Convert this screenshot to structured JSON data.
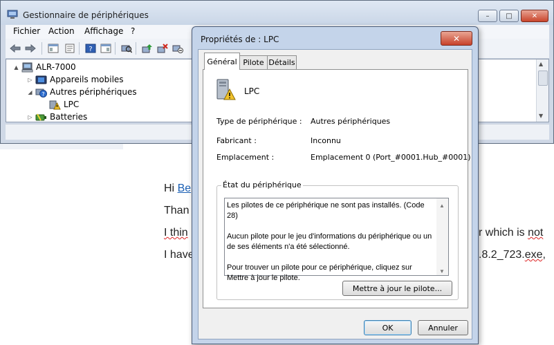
{
  "main_window": {
    "title": "Gestionnaire de périphériques",
    "controls": {
      "minimize": "–",
      "maximize": "□",
      "close": "✕"
    },
    "menu": [
      "Fichier",
      "Action",
      "Affichage",
      "?"
    ],
    "tree": [
      {
        "label": "ALR-7000",
        "icon": "computer-icon",
        "toggle": "▲"
      },
      {
        "label": "Appareils mobiles",
        "icon": "mobile-device-icon",
        "toggle": "▷"
      },
      {
        "label": "Autres périphériques",
        "icon": "unknown-device-icon",
        "toggle": "◢"
      },
      {
        "label": "LPC",
        "icon": "warning-device-icon",
        "toggle": ""
      },
      {
        "label": "Batteries",
        "icon": "battery-icon",
        "toggle": "▷"
      }
    ],
    "scroll_up": "▲",
    "scroll_down": "▼"
  },
  "background_text": {
    "line1_prefix": "Hi ",
    "line1_link": "Be",
    "line2": "Than",
    "line3_left": "I thin",
    "line3_right_a": "r which is ",
    "line3_right_b": "not",
    "line4_left": "I have",
    "line4_right_a": ".8.2_723.",
    "line4_right_b": "exe",
    "line4_right_c": ","
  },
  "dialog": {
    "title": "Propriétés de : LPC",
    "close": "✕",
    "tabs": [
      "Général",
      "Pilote",
      "Détails"
    ],
    "device_name": "LPC",
    "fields": {
      "type_label": "Type de périphérique :",
      "type_value": "Autres périphériques",
      "maker_label": "Fabricant :",
      "maker_value": "Inconnu",
      "location_label": "Emplacement :",
      "location_value": "Emplacement 0 (Port_#0001.Hub_#0001)"
    },
    "status_group_title": "État du périphérique",
    "status_lines": [
      "Les pilotes de ce périphérique ne sont pas installés. (Code 28)",
      "Aucun pilote pour le jeu d'informations du périphérique ou un de ses éléments n'a été sélectionné.",
      "Pour trouver un pilote pour ce périphérique, cliquez sur Mettre à jour le pilote."
    ],
    "update_button": "Mettre à jour le pilote...",
    "ok_button": "OK",
    "cancel_button": "Annuler",
    "scroll_up": "▲",
    "scroll_down": "▼"
  },
  "colors": {
    "window_frame": "#cfd8e6",
    "dialog_frame": "#c4d4ea",
    "close_red": "#c9452c",
    "link_blue": "#1a5fb4"
  }
}
